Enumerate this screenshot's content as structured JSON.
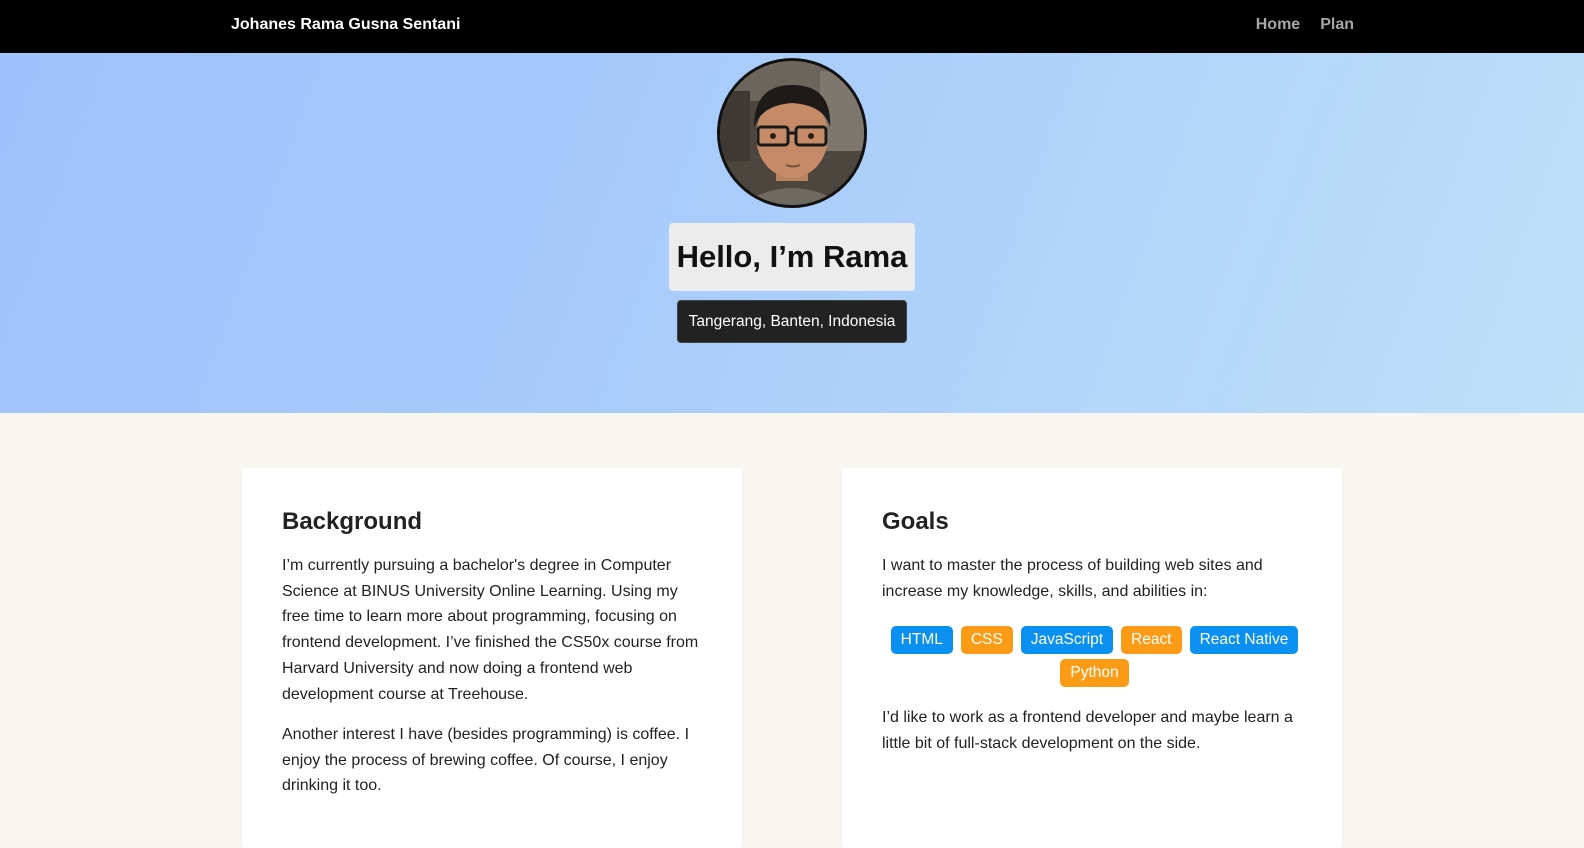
{
  "navbar": {
    "brand": "Johanes Rama Gusna Sentani",
    "links": [
      "Home",
      "Plan"
    ]
  },
  "hero": {
    "greeting": "Hello, I’m Rama",
    "location": "Tangerang, Banten, Indonesia",
    "avatar_icon": "profile-photo"
  },
  "background": {
    "title": "Background",
    "p1": "I’m currently pursuing a bachelor's degree in Computer Science at BINUS University Online Learning. Using my free time to learn more about programming, focusing on frontend development. I’ve finished the CS50x course from Harvard University and now doing a frontend web development course at Treehouse.",
    "p2": "Another interest I have (besides programming) is coffee. I enjoy the process of brewing coffee. Of course, I enjoy drinking it too."
  },
  "goals": {
    "title": "Goals",
    "p1": "I want to master the process of building web sites and increase my knowledge, skills, and abilities in:",
    "tags": [
      {
        "label": "HTML",
        "color": "blue"
      },
      {
        "label": "CSS",
        "color": "orange"
      },
      {
        "label": "JavaScript",
        "color": "blue"
      },
      {
        "label": "React",
        "color": "orange"
      },
      {
        "label": "React Native",
        "color": "blue"
      },
      {
        "label": "Python",
        "color": "orange"
      }
    ],
    "p2": "I’d like to work as a frontend developer and maybe learn a little bit of full-stack development on the side."
  },
  "colors": {
    "navbar": "#000000",
    "tag_blue": "#0a90f0",
    "tag_orange": "#fb9b16",
    "page_bg": "#f6f5f0"
  }
}
